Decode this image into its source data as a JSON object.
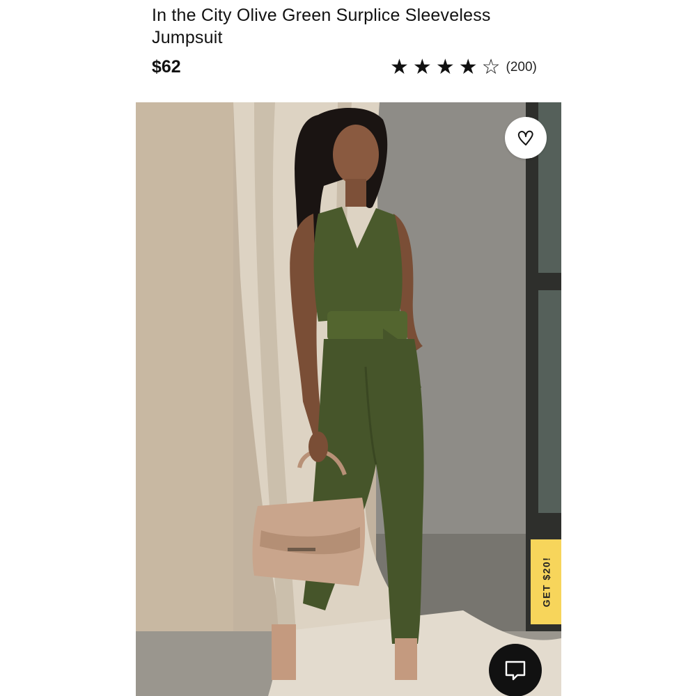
{
  "product": {
    "title": "In the City Olive Green Surplice Sleeveless Jumpsuit",
    "price": "$62",
    "rating": 4,
    "rating_max": 5,
    "review_count": "(200)"
  },
  "stars": [
    "★",
    "★",
    "★",
    "★",
    "☆"
  ],
  "promo": {
    "label": "GET $20!"
  },
  "icons": {
    "favorite": "heart-icon",
    "chat": "chat-icon"
  },
  "colors": {
    "promo_bg": "#f7d55b",
    "chat_bg": "#111111",
    "jumpsuit": "#4a5a2c"
  }
}
